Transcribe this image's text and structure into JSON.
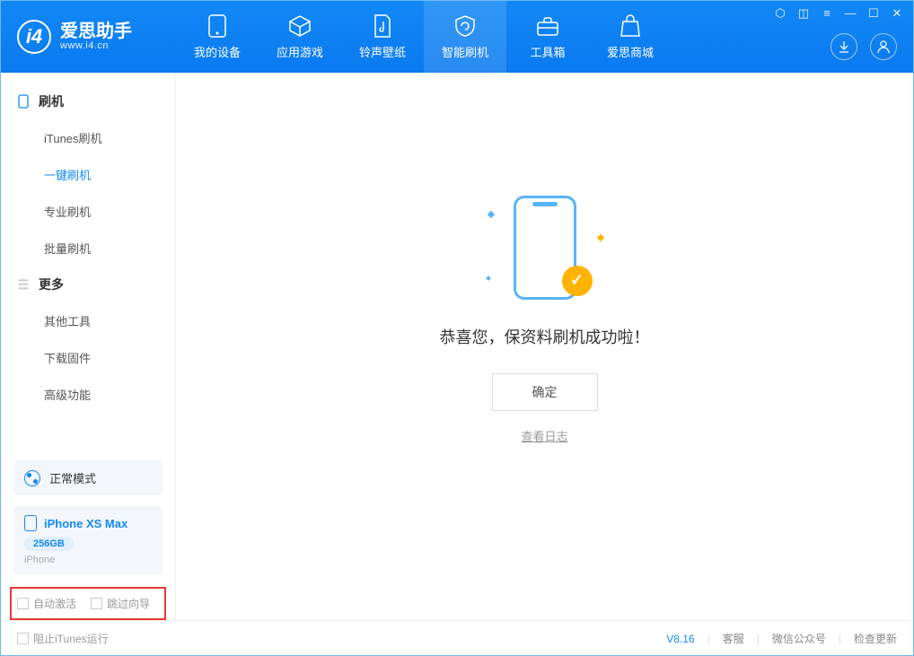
{
  "app": {
    "name": "爱思助手",
    "url": "www.i4.cn"
  },
  "tabs": [
    {
      "label": "我的设备"
    },
    {
      "label": "应用游戏"
    },
    {
      "label": "铃声壁纸"
    },
    {
      "label": "智能刷机"
    },
    {
      "label": "工具箱"
    },
    {
      "label": "爱思商城"
    }
  ],
  "sidebar": {
    "group1": {
      "title": "刷机",
      "items": [
        "iTunes刷机",
        "一键刷机",
        "专业刷机",
        "批量刷机"
      ]
    },
    "group2": {
      "title": "更多",
      "items": [
        "其他工具",
        "下载固件",
        "高级功能"
      ]
    }
  },
  "mode": {
    "label": "正常模式"
  },
  "device": {
    "name": "iPhone XS Max",
    "storage": "256GB",
    "type": "iPhone"
  },
  "bottom_checks": {
    "auto_activate": "自动激活",
    "skip_guide": "跳过向导"
  },
  "main": {
    "success": "恭喜您，保资料刷机成功啦！",
    "ok": "确定",
    "view_log": "查看日志"
  },
  "footer": {
    "block_itunes": "阻止iTunes运行",
    "version": "V8.16",
    "links": [
      "客服",
      "微信公众号",
      "检查更新"
    ]
  }
}
